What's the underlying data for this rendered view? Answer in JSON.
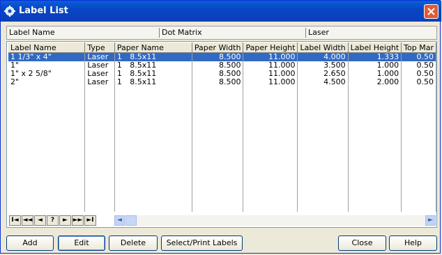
{
  "window": {
    "title": "Label List"
  },
  "header_bar": [
    "Label Name",
    "Dot Matrix",
    "Laser"
  ],
  "grid": {
    "columns": [
      "Label Name",
      "Type",
      "Paper Name",
      "Paper Width",
      "Paper Height",
      "Label Width",
      "Label Height",
      "Top Mar"
    ],
    "rows": [
      [
        "1 1/3\" x 4\"",
        "Laser",
        "1",
        "8.5x11",
        "8.500",
        "11.000",
        "4.000",
        "1.333",
        "0.50"
      ],
      [
        "1\"",
        "Laser",
        "1",
        "8.5x11",
        "8.500",
        "11.000",
        "3.500",
        "1.000",
        "0.50"
      ],
      [
        "1\" x 2 5/8\"",
        "Laser",
        "1",
        "8.5x11",
        "8.500",
        "11.000",
        "2.650",
        "1.000",
        "0.50"
      ],
      [
        "2\"",
        "Laser",
        "1",
        "8.5x11",
        "8.500",
        "11.000",
        "4.500",
        "2.000",
        "0.50"
      ]
    ],
    "selected_row": 0
  },
  "nav_buttons": [
    "I◄",
    "◄◄",
    "◄",
    "?",
    "►",
    "►►",
    "►I"
  ],
  "buttons": {
    "add": "Add",
    "edit": "Edit",
    "delete": "Delete",
    "select_print": "Select/Print Labels",
    "close": "Close",
    "help": "Help"
  },
  "colors": {
    "selection": "#316ac5",
    "titlebar": "#0846c4",
    "close": "#e35a32"
  },
  "icons": {
    "title": "gear-icon",
    "close": "close-icon"
  }
}
